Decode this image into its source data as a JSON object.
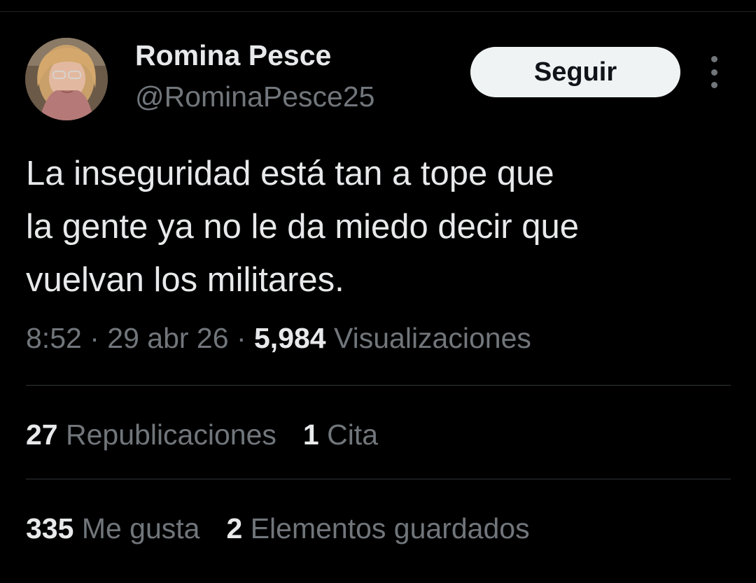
{
  "author": {
    "name": "Romina Pesce",
    "handle": "@RominaPesce25"
  },
  "follow_button": {
    "label": "Seguir"
  },
  "more_icon": "more-vertical-icon",
  "tweet": {
    "lines": [
      "La inseguridad está tan a tope que",
      "la gente ya no le da miedo decir que",
      "vuelvan los militares."
    ]
  },
  "meta": {
    "time": "8:52",
    "separator": "·",
    "date": "29 abr 26",
    "views_count": "5,984",
    "views_label": "Visualizaciones"
  },
  "stats_row1": [
    {
      "count": "27",
      "label": "Republicaciones"
    },
    {
      "count": "1",
      "label": "Cita"
    }
  ],
  "stats_row2": [
    {
      "count": "335",
      "label": "Me gusta"
    },
    {
      "count": "2",
      "label": "Elementos guardados"
    }
  ],
  "colors": {
    "background": "#000000",
    "primary_text": "#e7e9ea",
    "secondary_text": "#71767b",
    "button_bg": "#eff3f4",
    "divider": "#2f3336"
  }
}
